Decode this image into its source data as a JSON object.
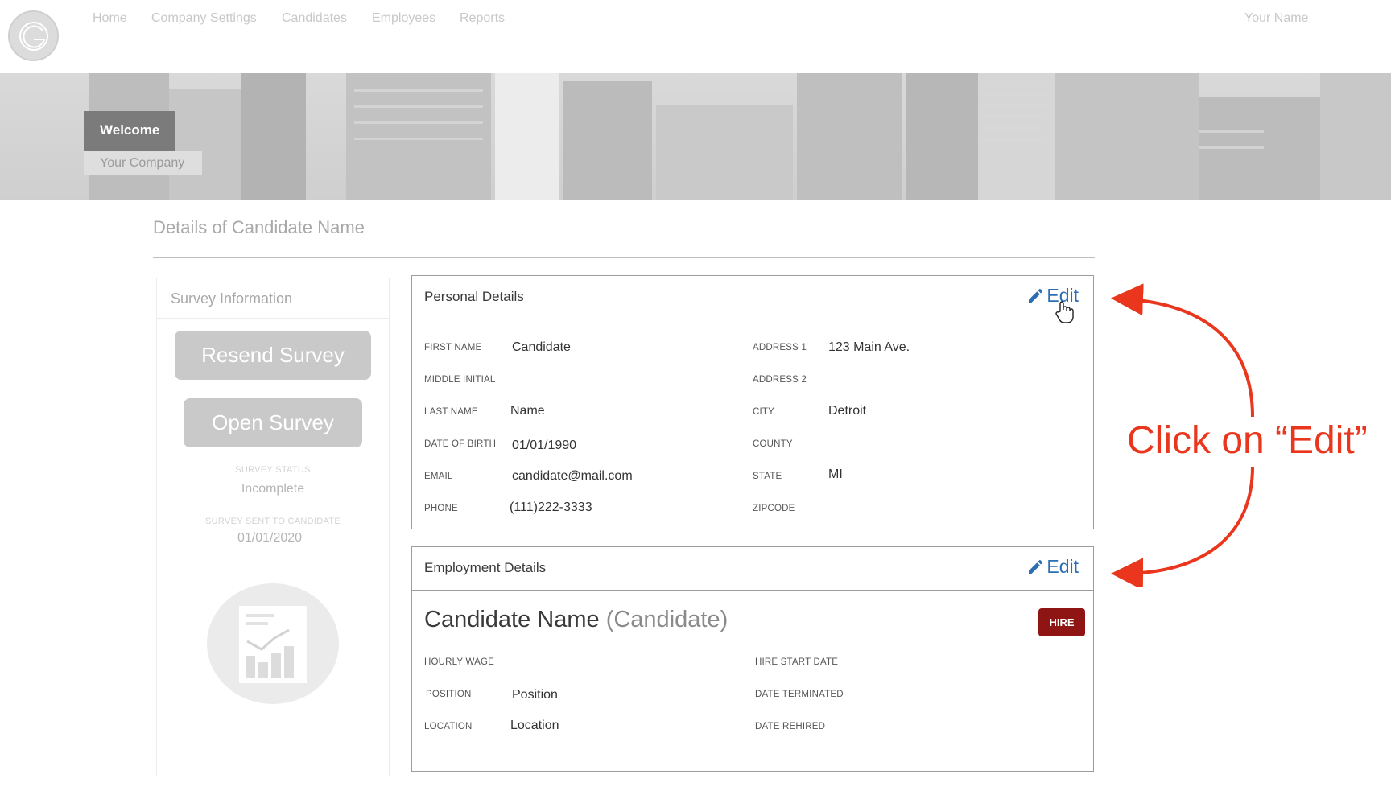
{
  "nav": {
    "items": [
      "Home",
      "Company Settings",
      "Candidates",
      "Employees",
      "Reports"
    ],
    "user_name": "Your Name"
  },
  "banner": {
    "welcome": "Welcome",
    "company": "Your Company"
  },
  "page": {
    "title": "Details of Candidate Name"
  },
  "survey": {
    "heading": "Survey Information",
    "resend_label": "Resend Survey",
    "open_label": "Open Survey",
    "status_label": "SURVEY STATUS",
    "status_value": "Incomplete",
    "sent_label": "SURVEY SENT TO CANDIDATE",
    "sent_value": "01/01/2020",
    "report_icon": "report-chart-icon"
  },
  "personal": {
    "title": "Personal Details",
    "edit_label": "Edit",
    "fields": {
      "first_name": {
        "label": "FIRST NAME",
        "value": "Candidate"
      },
      "middle_initial": {
        "label": "MIDDLE INITIAL",
        "value": ""
      },
      "last_name": {
        "label": "LAST NAME",
        "value": "Name"
      },
      "dob": {
        "label": "DATE OF BIRTH",
        "value": "01/01/1990"
      },
      "email": {
        "label": "EMAIL",
        "value": "candidate@mail.com"
      },
      "phone": {
        "label": "PHONE",
        "value": "(111)222-3333"
      },
      "address1": {
        "label": "ADDRESS 1",
        "value": "123 Main Ave."
      },
      "address2": {
        "label": "ADDRESS 2",
        "value": ""
      },
      "city": {
        "label": "CITY",
        "value": "Detroit"
      },
      "county": {
        "label": "COUNTY",
        "value": ""
      },
      "state": {
        "label": "STATE",
        "value": "MI"
      },
      "zipcode": {
        "label": "ZIPCODE",
        "value": ""
      }
    }
  },
  "employment": {
    "title": "Employment Details",
    "edit_label": "Edit",
    "candidate_name": "Candidate Name",
    "candidate_role": "(Candidate)",
    "hire_label": "HIRE",
    "fields": {
      "hourly_wage": {
        "label": "HOURLY WAGE",
        "value": ""
      },
      "position": {
        "label": "POSITION",
        "value": "Position"
      },
      "location": {
        "label": "LOCATION",
        "value": "Location"
      },
      "hire_start": {
        "label": "HIRE START DATE",
        "value": ""
      },
      "terminated": {
        "label": "DATE TERMINATED",
        "value": ""
      },
      "rehired": {
        "label": "DATE REHIRED",
        "value": ""
      }
    }
  },
  "annotation": {
    "text": "Click on “Edit”",
    "color": "#e9361c"
  },
  "colors": {
    "edit_blue": "#2a6fb3",
    "hire_red": "#8f1414"
  }
}
